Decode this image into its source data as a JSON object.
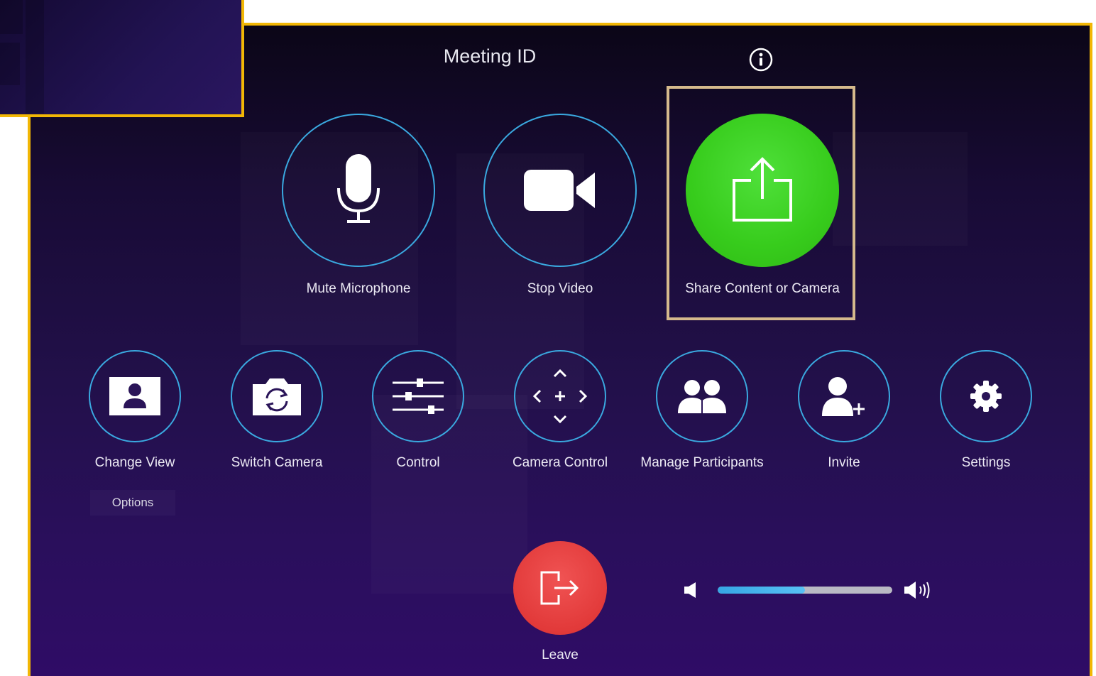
{
  "header": {
    "meeting_id_label": "Meeting ID"
  },
  "primary_controls": [
    {
      "label": "Mute Microphone",
      "icon": "microphone-icon"
    },
    {
      "label": "Stop Video",
      "icon": "video-camera-icon"
    },
    {
      "label": "Share Content or Camera",
      "icon": "share-upload-icon"
    }
  ],
  "secondary_controls": [
    {
      "label": "Change View",
      "icon": "change-view-icon"
    },
    {
      "label": "Switch Camera",
      "icon": "switch-camera-icon"
    },
    {
      "label": "Control",
      "icon": "sliders-icon"
    },
    {
      "label": "Camera Control",
      "icon": "camera-control-arrows-icon"
    },
    {
      "label": "Manage Participants",
      "icon": "participants-icon"
    },
    {
      "label": "Invite",
      "icon": "add-user-icon"
    },
    {
      "label": "Settings",
      "icon": "gear-icon"
    }
  ],
  "options_label": "Options",
  "leave": {
    "label": "Leave",
    "icon": "exit-icon"
  },
  "volume": {
    "level": 0.5
  },
  "colors": {
    "accent_ring": "#3aa9e0",
    "share_green": "#37cc1c",
    "leave_red": "#e23a3a",
    "frame_outline": "#f2b705",
    "highlight_box": "#d5b98c"
  }
}
